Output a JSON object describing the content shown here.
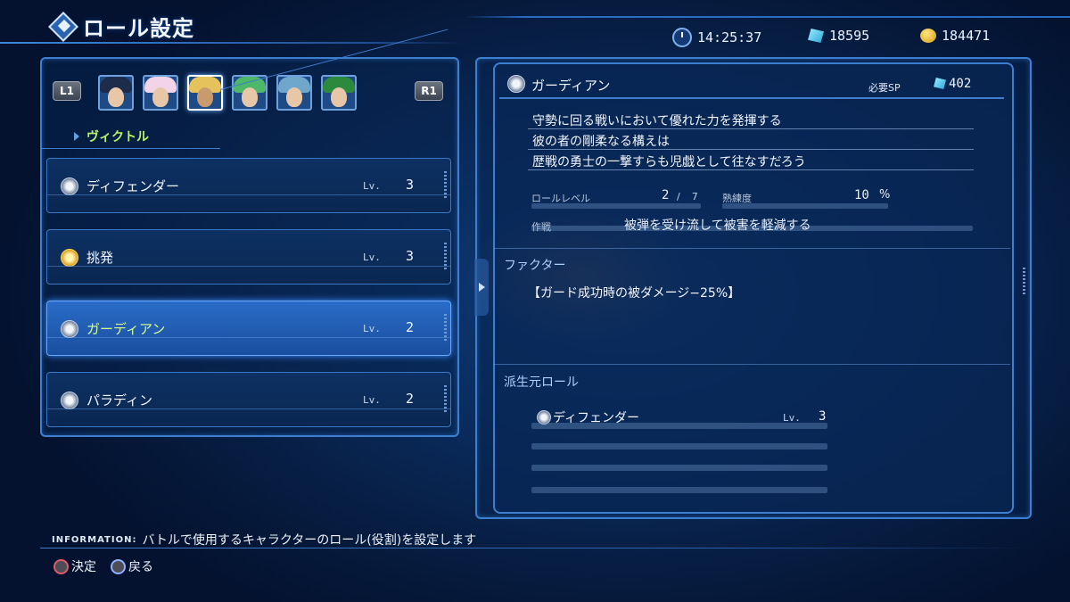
{
  "header": {
    "title": "ロール設定",
    "time": "14:25:37",
    "crystals": "18595",
    "gold": "184471"
  },
  "left": {
    "l_button": "L1",
    "r_button": "R1",
    "portraits": [
      {
        "hair_color": "#1d2c4a"
      },
      {
        "hair_color": "#f2d4e8"
      },
      {
        "hair_color": "#e6c25c"
      },
      {
        "hair_color": "#4db86a"
      },
      {
        "hair_color": "#6fa6cc"
      },
      {
        "hair_color": "#2c8a3c"
      }
    ],
    "character_name": "ヴィクトル",
    "roles": [
      {
        "name": "ディフェンダー",
        "lv_label": "Lv.",
        "level": "3",
        "icon": "shield-icon",
        "selected": false
      },
      {
        "name": "挑発",
        "lv_label": "Lv.",
        "level": "3",
        "icon": "cross-badge-icon",
        "selected": false
      },
      {
        "name": "ガーディアン",
        "lv_label": "Lv.",
        "level": "2",
        "icon": "shield-icon",
        "selected": true
      },
      {
        "name": "パラディン",
        "lv_label": "Lv.",
        "level": "2",
        "icon": "shield-icon",
        "selected": false
      }
    ]
  },
  "detail": {
    "title": "ガーディアン",
    "sp_label": "必要SP",
    "sp_value": "402",
    "description": [
      "守勢に回る戦いにおいて優れた力を発揮する",
      "彼の者の剛柔なる構えは",
      "歴戦の勇士の一撃すらも児戯として往なすだろう"
    ],
    "role_level_label": "ロールレベル",
    "role_level": "2",
    "role_level_sep": "/",
    "role_level_max": "7",
    "proficiency_label": "熟練度",
    "proficiency": "10",
    "proficiency_unit": "%",
    "tactic_label": "作戦",
    "tactic": "被弾を受け流して被害を軽減する",
    "factor_title": "ファクター",
    "factor": "【ガード成功時の被ダメージ−25%】",
    "derived_title": "派生元ロール",
    "derived": {
      "name": "ディフェンダー",
      "lv_label": "Lv.",
      "level": "3"
    }
  },
  "footer": {
    "info_label": "INFORMATION:",
    "info_text": "バトルで使用するキャラクターのロール(役割)を設定します",
    "confirm": "決定",
    "back": "戻る"
  }
}
